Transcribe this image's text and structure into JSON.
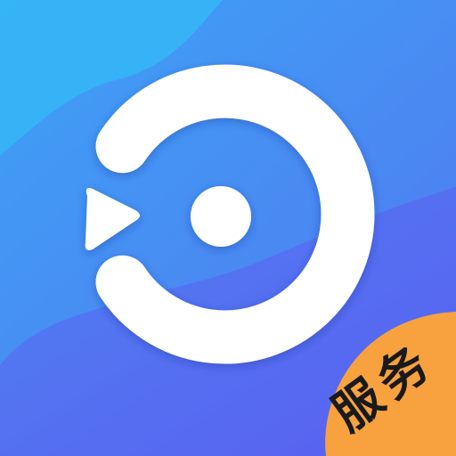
{
  "app_icon": {
    "logo": "play-circle-logo",
    "badge": {
      "label": "服务",
      "color": "#f7a23f"
    },
    "colors": {
      "background_light": "#34a8f3",
      "background_mid": "#4b8df0",
      "background_dark": "#5a5ff0",
      "logo": "#ffffff"
    }
  }
}
